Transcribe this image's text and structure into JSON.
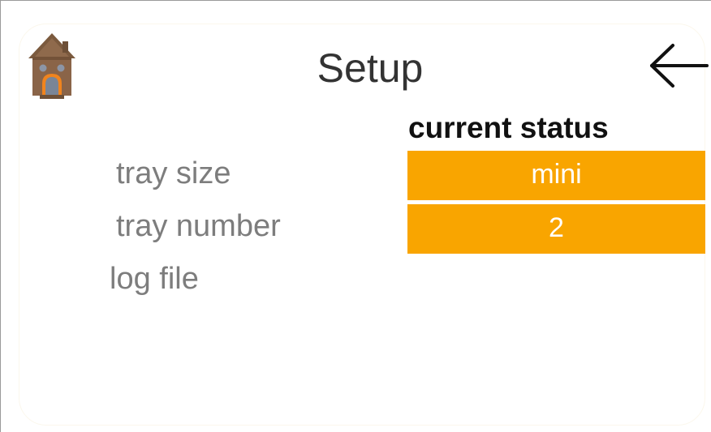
{
  "header": {
    "title": "Setup",
    "home_icon": "house-icon",
    "back_icon": "arrow-left-icon"
  },
  "status": {
    "header": "current status",
    "tray_size_value": "mini",
    "tray_number_value": "2"
  },
  "settings": {
    "tray_size_label": "tray size",
    "tray_number_label": "tray number",
    "log_file_label": "log file"
  },
  "colors": {
    "accent_orange": "#f9a500",
    "label_gray": "#7d7d7d",
    "house_body": "#8a6448",
    "house_roof": "#7b5a3e",
    "house_door": "#f0841e"
  }
}
